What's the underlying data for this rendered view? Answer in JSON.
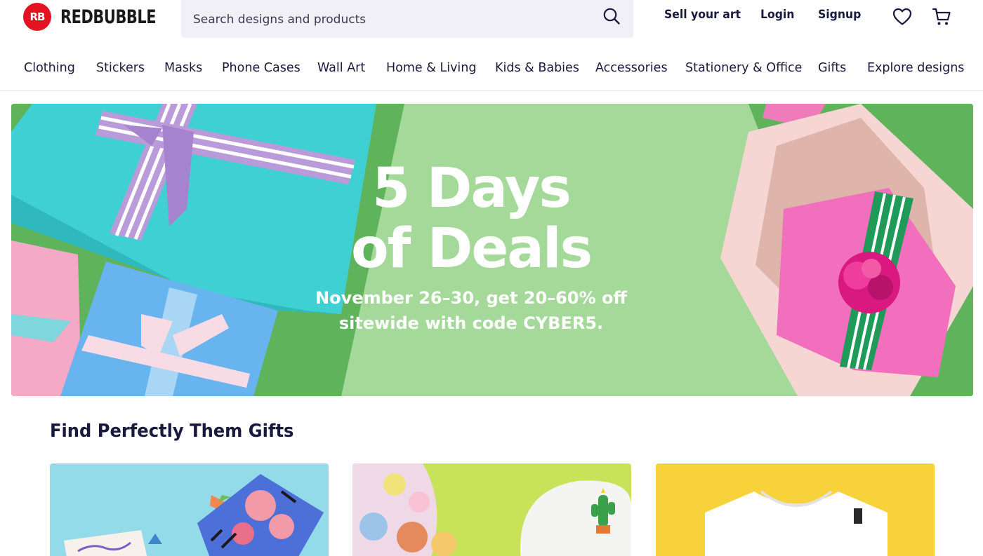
{
  "header": {
    "logo_mark": "RB",
    "logo_text": "REDBUBBLE",
    "search_placeholder": "Search designs and products",
    "links": {
      "sell": "Sell your art",
      "login": "Login",
      "signup": "Signup"
    },
    "icons": [
      "search-icon",
      "heart-icon",
      "cart-icon"
    ]
  },
  "categories": [
    "Clothing",
    "Stickers",
    "Masks",
    "Phone Cases",
    "Wall Art",
    "Home & Living",
    "Kids & Babies",
    "Accessories",
    "Stationery & Office",
    "Gifts",
    "Explore designs"
  ],
  "hero": {
    "title_line1": "5 Days",
    "title_line2": "of Deals",
    "subtitle_line1": "November 26–30, get 20–60% off",
    "subtitle_line2": "sitewide with code CYBER5."
  },
  "section": {
    "title": "Find Perfectly Them Gifts"
  },
  "colors": {
    "brand_red": "#e41321",
    "text_navy": "#191a3d",
    "search_bg": "#f0f0f6",
    "hero_green": "#a5d99a",
    "card1_bg": "#93dbe8",
    "card2_bg": "#c8e35a",
    "card3_bg": "#f7d23a"
  }
}
